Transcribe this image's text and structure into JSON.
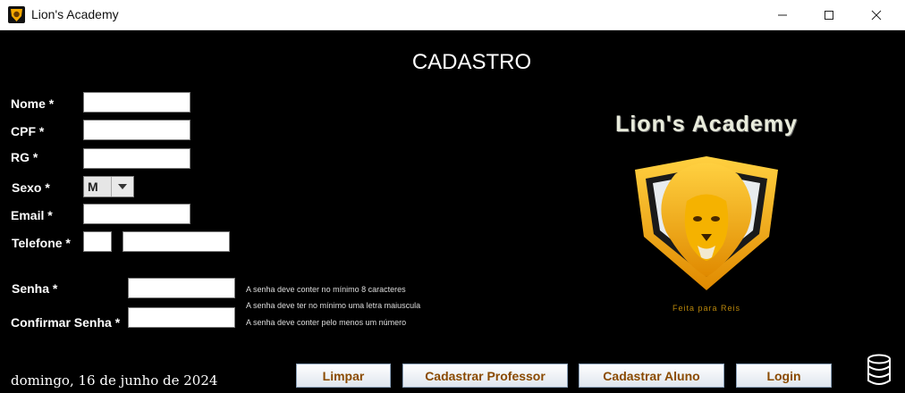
{
  "window": {
    "title": "Lion's Academy"
  },
  "form": {
    "heading": "CADASTRO",
    "nome_label": "Nome *",
    "cpf_label": "CPF *",
    "rg_label": "RG *",
    "sexo_label": "Sexo *",
    "sexo_value": "M",
    "email_label": "Email *",
    "telefone_label": "Telefone *",
    "senha_label": "Senha *",
    "confirmar_label": "Confirmar Senha *"
  },
  "hints": [
    "A senha deve conter no mínimo 8 caracteres",
    "A senha deve ter no mínimo uma letra maiuscula",
    "A senha deve conter pelo menos um número"
  ],
  "footer": {
    "date": "domingo, 16 de junho de 2024"
  },
  "buttons": {
    "limpar": "Limpar",
    "cadastrar_professor": "Cadastrar Professor",
    "cadastrar_aluno": "Cadastrar Aluno",
    "login": "Login"
  },
  "logo": {
    "title": "Lion's Academy",
    "motto": "Feita para Reis"
  },
  "colors": {
    "background": "#000000",
    "button_text": "#8a4a00",
    "gold": "#f5a800"
  },
  "icons": [
    "app-logo-icon",
    "minimize-icon",
    "maximize-icon",
    "close-icon",
    "chevron-down-icon",
    "database-icon"
  ]
}
